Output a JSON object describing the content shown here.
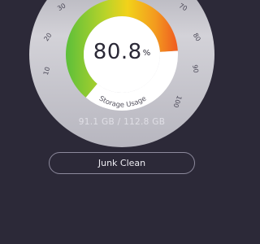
{
  "gauge": {
    "percent": 80.8,
    "value_text": "80.8",
    "unit": "%",
    "label": "Storage Usage",
    "tick_labels": [
      "10",
      "20",
      "30",
      "70",
      "80",
      "90",
      "100"
    ],
    "colors": {
      "green": "#6bc43b",
      "yellow": "#f2d21a",
      "orange": "#f39a1f",
      "red": "#ef5a20",
      "dial_face": "#c9c8cf",
      "inner_circle": "#ffffff"
    }
  },
  "storage": {
    "used": "91.1 GB",
    "separator": "/",
    "total": "112.8 GB",
    "display": "91.1 GB  /  112.8 GB"
  },
  "buttons": {
    "junk_clean": "Junk Clean"
  },
  "theme": {
    "background": "#2c2938",
    "button_border": "#8c899c"
  }
}
